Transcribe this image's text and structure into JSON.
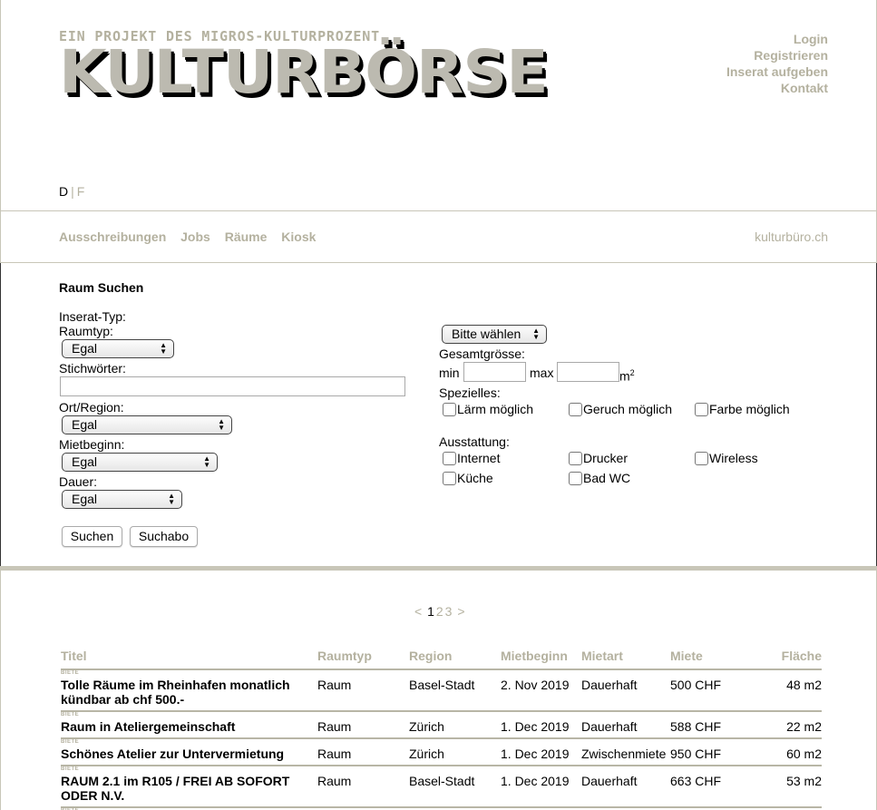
{
  "header": {
    "tagline": "Ein Projekt des Migros-Kulturprozent",
    "logo_text": "KULTURBÖRSE",
    "top_links": [
      "Login",
      "Registrieren",
      "Inserat aufgeben",
      "Kontakt"
    ],
    "lang_active": "D",
    "lang_sep": "|",
    "lang_other": "F"
  },
  "nav": {
    "items": [
      "Ausschreibungen",
      "Jobs",
      "Räume",
      "Kiosk"
    ],
    "site_link": "kulturbüro.ch"
  },
  "search": {
    "title": "Raum Suchen",
    "inserat_typ_label": "Inserat-Typ:",
    "inserat_typ_value": "Bitte wählen",
    "raumtyp_label": "Raumtyp:",
    "raumtyp_value": "Egal",
    "stichwoerter_label": "Stichwörter:",
    "stichwoerter_value": "",
    "ort_label": "Ort/Region:",
    "ort_value": "Egal",
    "mietbeginn_label": "Mietbeginn:",
    "mietbeginn_value": "Egal",
    "dauer_label": "Dauer:",
    "dauer_value": "Egal",
    "gesamtgroesse_label": "Gesamtgrösse:",
    "min_label": "min",
    "max_label": "max",
    "unit": "m",
    "unit_sup": "2",
    "spezielles_label": "Spezielles:",
    "spezielles": [
      "Lärm möglich",
      "Geruch möglich",
      "Farbe möglich"
    ],
    "ausstattung_label": "Ausstattung:",
    "ausstattung": [
      "Internet",
      "Drucker",
      "Wireless",
      "Küche",
      "Bad WC"
    ],
    "buttons": {
      "search": "Suchen",
      "abo": "Suchabo"
    }
  },
  "results": {
    "pager": {
      "prev": "<",
      "pages": [
        "1",
        "2",
        "3"
      ],
      "next": ">"
    },
    "columns": [
      "Titel",
      "Raumtyp",
      "Region",
      "Mietbeginn",
      "Mietart",
      "Miete",
      "Fläche"
    ],
    "tag": "BIETE",
    "rows": [
      {
        "title": "Tolle Räume im Rheinhafen monatlich kündbar ab chf 500.-",
        "raumtyp": "Raum",
        "region": "Basel-Stadt",
        "mietbeginn": "2. Nov 2019",
        "mietart": "Dauerhaft",
        "miete": "500 CHF",
        "flaeche": "48 m2"
      },
      {
        "title": "Raum in Ateliergemeinschaft",
        "raumtyp": "Raum",
        "region": "Zürich",
        "mietbeginn": "1. Dec 2019",
        "mietart": "Dauerhaft",
        "miete": "588 CHF",
        "flaeche": "22 m2"
      },
      {
        "title": "Schönes Atelier zur Untervermietung",
        "raumtyp": "Raum",
        "region": "Zürich",
        "mietbeginn": "1. Dec 2019",
        "mietart": "Zwischenmiete",
        "miete": "950 CHF",
        "flaeche": "60 m2"
      },
      {
        "title": "RAUM 2.1 im R105 / FREI AB SOFORT ODER N.V.",
        "raumtyp": "Raum",
        "region": "Basel-Stadt",
        "mietbeginn": "1. Dec 2019",
        "mietart": "Dauerhaft",
        "miete": "663 CHF",
        "flaeche": "53 m2"
      }
    ]
  }
}
